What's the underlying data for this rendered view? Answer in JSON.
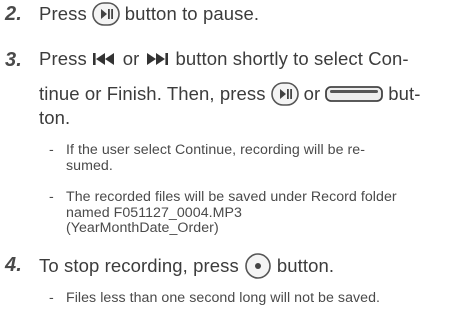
{
  "steps": [
    {
      "number": "2.",
      "line1_before": "Press",
      "line1_after": "button to pause.",
      "icon": "play-pause-icon"
    },
    {
      "number": "3.",
      "line1_before": "Press",
      "line1_or": "or",
      "line1_after": "button shortly to select Con-",
      "line2_before": "tinue or Finish. Then, press",
      "line2_or": "or",
      "line2_after": "but-",
      "line3": "ton.",
      "icons": [
        "skip-back-icon",
        "skip-forward-icon",
        "play-pause-icon",
        "long-bar-button-icon"
      ]
    },
    {
      "number": "4.",
      "line1_before": "To stop recording, press",
      "line1_after": "button.",
      "icon": "record-stop-icon"
    }
  ],
  "notes": {
    "continue_line1": "If the user select Continue, recording will be re-",
    "continue_line2": "sumed.",
    "saved_line1": "The recorded files will be saved under Record folder",
    "saved_line2": "named F051127_0004.MP3",
    "saved_line3": "(YearMonthDate_Order)",
    "short_files": "Files less than one second long will not be saved."
  },
  "dash": "-"
}
